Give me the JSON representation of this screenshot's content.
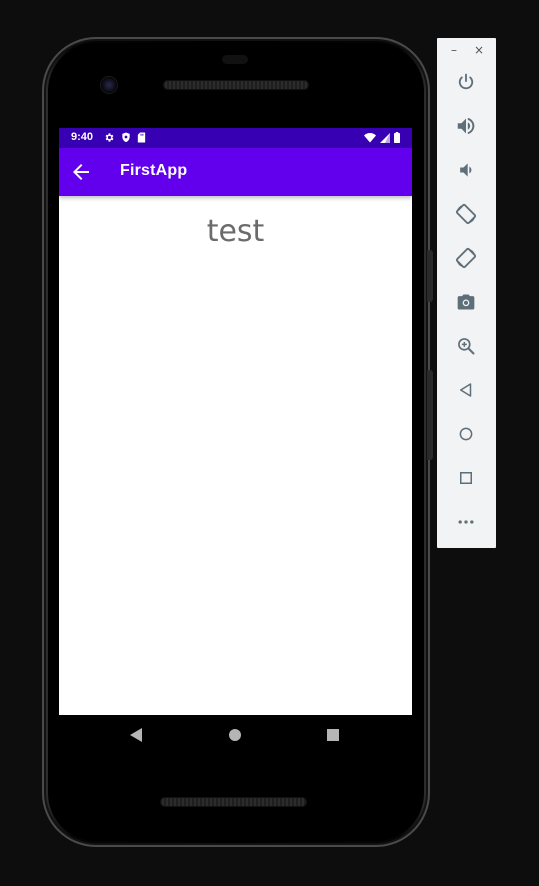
{
  "status_bar": {
    "time": "9:40",
    "left_icons": [
      "gear-icon",
      "shield-icon",
      "sd-card-icon"
    ],
    "right_icons": [
      "wifi-icon",
      "cell-signal-icon",
      "battery-icon"
    ],
    "color": "#3700b3"
  },
  "app_bar": {
    "title": "FirstApp",
    "color": "#6200ee"
  },
  "content": {
    "text": "test"
  },
  "nav_bar": {
    "buttons": [
      "back-triangle-icon",
      "home-circle-icon",
      "recents-square-icon"
    ]
  },
  "emulator_toolbar": {
    "window_controls": [
      "minimize-icon",
      "close-icon"
    ],
    "minimize_label": "–",
    "close_label": "×",
    "buttons": [
      "power-icon",
      "volume-up-icon",
      "volume-down-icon",
      "rotate-left-icon",
      "rotate-right-icon",
      "camera-icon",
      "zoom-icon",
      "back-icon",
      "home-icon",
      "overview-icon",
      "more-icon"
    ],
    "icon_color": "#5f6f7a"
  }
}
